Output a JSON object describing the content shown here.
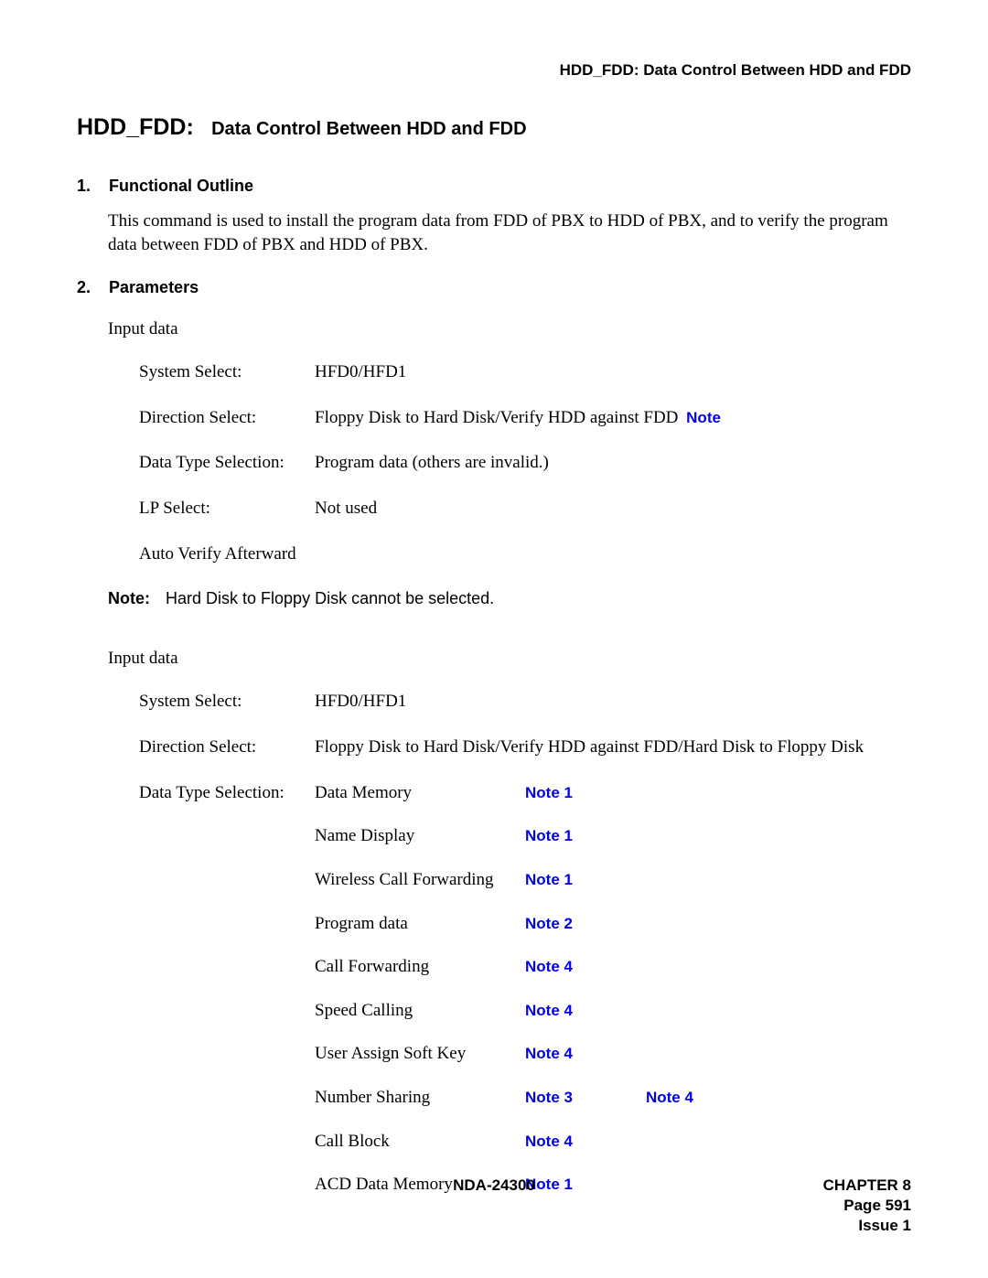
{
  "runningHead": "HDD_FDD: Data Control Between HDD and FDD",
  "title": {
    "code": "HDD_FDD",
    "sep": ":",
    "desc": "Data Control Between HDD and FDD"
  },
  "section1": {
    "num": "1.",
    "heading": "Functional Outline",
    "text": "This command is used to install the program data from FDD of PBX to HDD of PBX, and to verify the program data between FDD of PBX and HDD of PBX."
  },
  "section2": {
    "num": "2.",
    "heading": "Parameters"
  },
  "inputLabel": "Input data",
  "block1": {
    "systemSelect": {
      "label": "System Select:",
      "value": "HFD0/HFD1"
    },
    "directionSelect": {
      "label": "Direction Select:",
      "value": "Floppy Disk to Hard Disk/Verify HDD against FDD ",
      "noteLink": "Note"
    },
    "dataTypeSelection": {
      "label": "Data Type Selection:",
      "value": "Program data (others are invalid.)"
    },
    "lpSelect": {
      "label": "LP Select:",
      "value": "Not used"
    },
    "autoVerify": {
      "label": "Auto Verify Afterward"
    }
  },
  "noteLine": {
    "label": "Note:",
    "text": "Hard Disk to Floppy Disk cannot be selected."
  },
  "block2": {
    "systemSelect": {
      "label": "System Select:",
      "value": "HFD0/HFD1"
    },
    "directionSelect": {
      "label": "Direction Select:",
      "value": "Floppy Disk to Hard Disk/Verify HDD against FDD/Hard Disk to Floppy Disk"
    },
    "dataTypeSelection": {
      "label": "Data Type Selection:",
      "first": {
        "name": "Data Memory",
        "notes": [
          "Note 1"
        ]
      },
      "rows": [
        {
          "name": "Name Display",
          "notes": [
            "Note 1"
          ]
        },
        {
          "name": "Wireless Call Forwarding",
          "notes": [
            "Note 1"
          ]
        },
        {
          "name": "Program data",
          "notes": [
            "Note 2"
          ]
        },
        {
          "name": "Call Forwarding",
          "notes": [
            "Note 4"
          ]
        },
        {
          "name": "Speed Calling",
          "notes": [
            "Note 4"
          ]
        },
        {
          "name": "User Assign Soft Key",
          "notes": [
            "Note 4"
          ]
        },
        {
          "name": "Number Sharing",
          "notes": [
            "Note 3",
            "Note 4"
          ]
        },
        {
          "name": "Call Block",
          "notes": [
            "Note 4"
          ]
        },
        {
          "name": "ACD Data Memory",
          "notes": [
            "Note 1"
          ]
        }
      ]
    }
  },
  "footer": {
    "docId": "NDA-24300",
    "chapter": "CHAPTER 8",
    "page": "Page 591",
    "issue": "Issue 1"
  }
}
